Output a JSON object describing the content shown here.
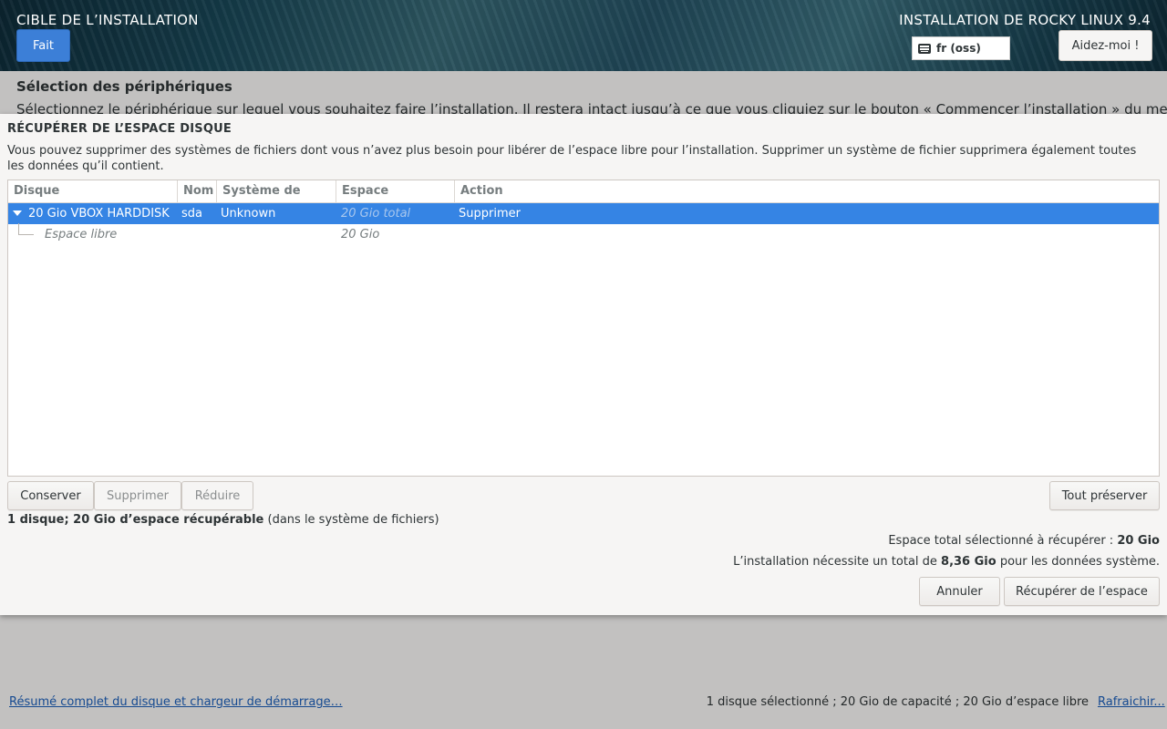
{
  "header": {
    "spoke_title": "CIBLE DE L’INSTALLATION",
    "done_label": "Fait",
    "product_title": "INSTALLATION DE ROCKY LINUX 9.4",
    "keyboard_layout": "fr (oss)",
    "help_label": "Aidez-moi !"
  },
  "background": {
    "section_title": "Sélection des périphériques",
    "section_desc": "Sélectionnez le périphérique sur lequel vous souhaitez faire l’installation. Il restera intact jusqu’à ce que vous cliquiez sur le bouton « Commencer l’installation » du menu",
    "summary_link": "Résumé complet du disque et chargeur de démarrage…",
    "status": "1 disque sélectionné ; 20 Gio de capacité ; 20 Gio d’espace libre",
    "refresh_link": "Rafraichir..."
  },
  "dialog": {
    "title": "RÉCUPÉRER DE L’ESPACE DISQUE",
    "description": "Vous pouvez supprimer des systèmes de fichiers dont vous n’avez plus besoin pour libérer de l’espace libre pour l’installation. Supprimer un système de fichier supprimera également toutes les données qu’il contient.",
    "columns": {
      "disk": "Disque",
      "name": "Nom",
      "filesystem": "Système de fichiers",
      "reclaimable": "Espace récupérable",
      "action": "Action"
    },
    "rows": [
      {
        "disk": "20 Gio VBOX HARDDISK",
        "name": "sda",
        "filesystem": "Unknown",
        "reclaimable": "20 Gio total",
        "action": "Supprimer"
      },
      {
        "disk": "Espace libre",
        "name": "",
        "filesystem": "",
        "reclaimable": "20 Gio",
        "action": ""
      }
    ],
    "buttons": {
      "keep": "Conserver",
      "delete": "Supprimer",
      "shrink": "Réduire",
      "preserve_all": "Tout préserver",
      "cancel": "Annuler",
      "reclaim": "Récupérer de l’espace"
    },
    "summary_bold": "1 disque; 20 Gio d’espace récupérable",
    "summary_rest": " (dans le système de fichiers)",
    "total_selected_label": "Espace total sélectionné à récupérer : ",
    "total_selected_value": "20 Gio",
    "required_prefix": "L’installation nécessite un total de ",
    "required_value": "8,36 Gio",
    "required_suffix": " pour les données système."
  }
}
